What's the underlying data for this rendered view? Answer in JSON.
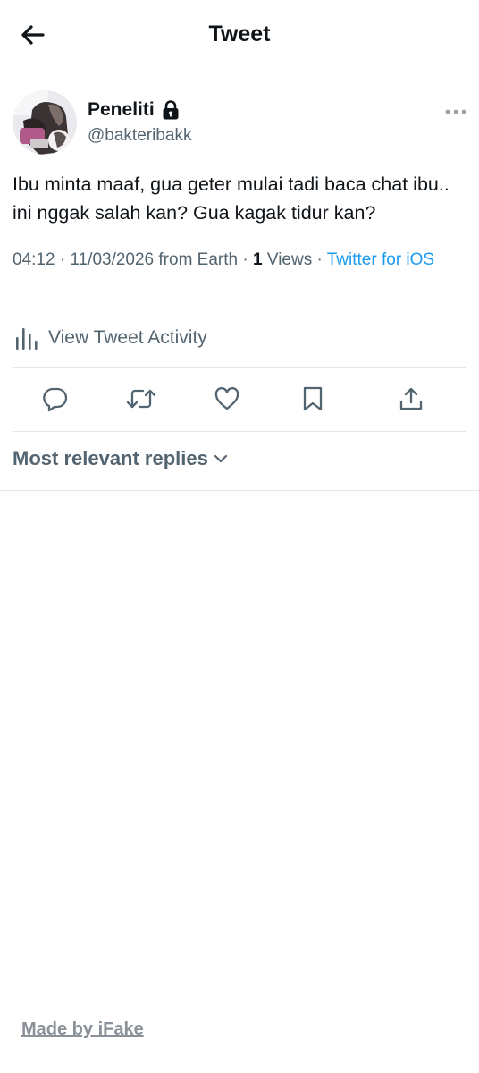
{
  "header": {
    "title": "Tweet",
    "back_icon": "arrow-left-icon"
  },
  "tweet": {
    "author": {
      "display_name": "Peneliti",
      "username": "@bakteribakk",
      "protected_icon": "lock-icon"
    },
    "text": "Ibu minta maaf, gua geter mulai tadi baca chat ibu.. ini nggak salah kan? Gua kagak tidur kan?",
    "meta": {
      "time": "04:12",
      "date": "11/03/2026",
      "location": "from Earth",
      "separator": " · ",
      "views_count": "1",
      "views_label": "Views",
      "source": "Twitter for iOS"
    }
  },
  "activity": {
    "label": "View Tweet Activity",
    "icon": "bar-chart-icon"
  },
  "actions": [
    {
      "name": "reply-icon"
    },
    {
      "name": "retweet-icon"
    },
    {
      "name": "like-icon"
    },
    {
      "name": "bookmark-icon"
    },
    {
      "name": "share-icon"
    }
  ],
  "replies": {
    "sort_label": "Most relevant replies",
    "icon": "chevron-down-icon"
  },
  "watermark": {
    "text": "Made by iFake"
  },
  "colors": {
    "link": "#1d9bf0",
    "secondary_text": "#536471",
    "primary_text": "#0f1419",
    "divider": "#e1e8ed"
  }
}
